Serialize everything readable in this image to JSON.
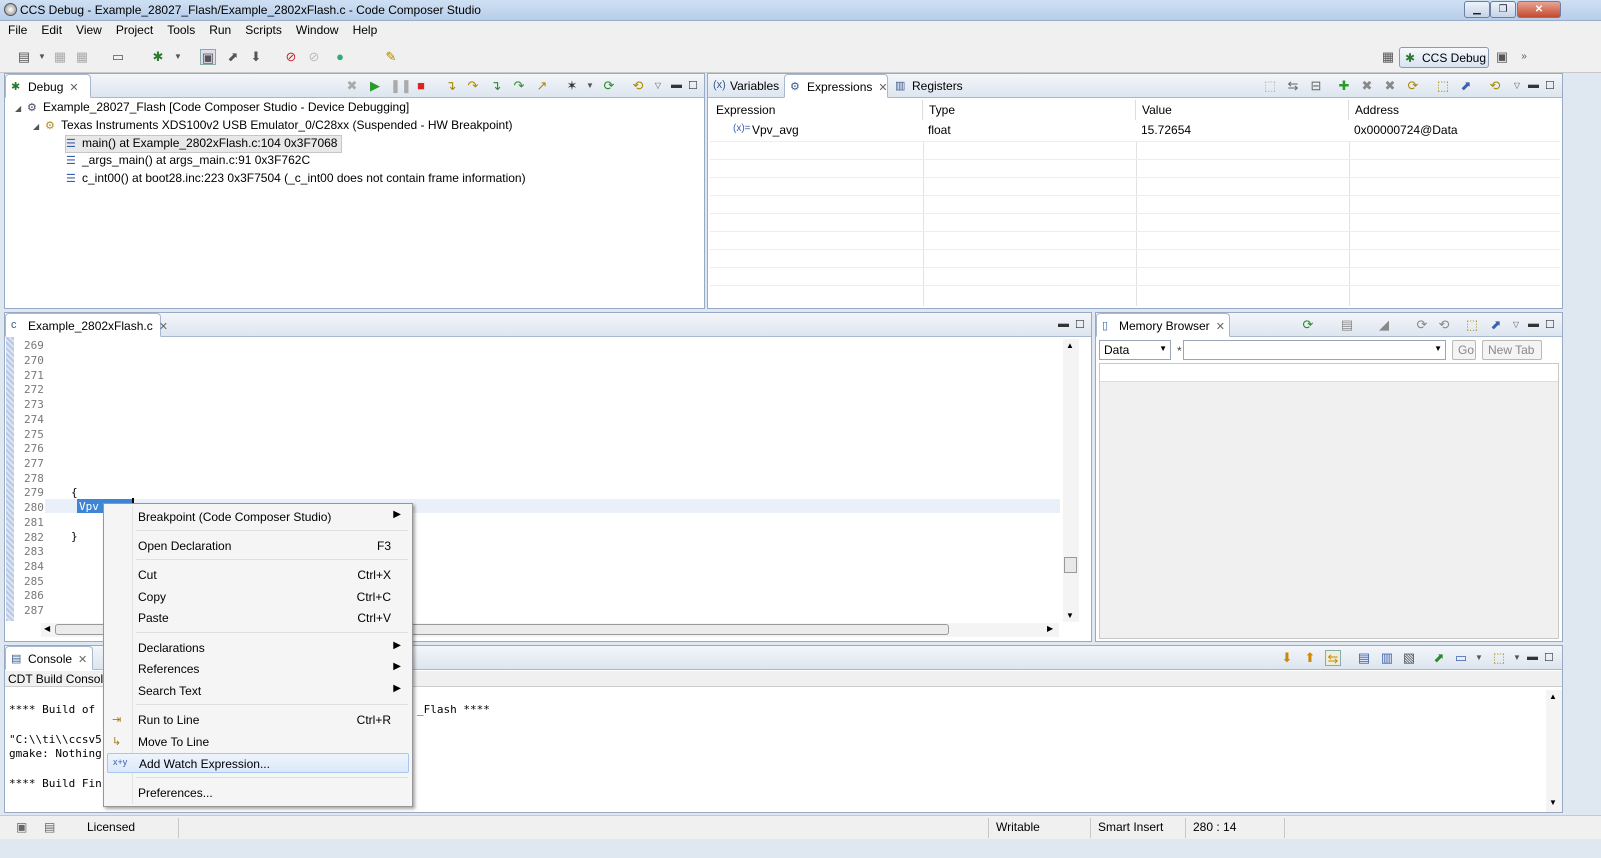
{
  "window": {
    "title": "CCS Debug - Example_28027_Flash/Example_2802xFlash.c - Code Composer Studio"
  },
  "menu": [
    "File",
    "Edit",
    "View",
    "Project",
    "Tools",
    "Run",
    "Scripts",
    "Window",
    "Help"
  ],
  "perspective": {
    "label": "CCS Debug"
  },
  "debug": {
    "tab": "Debug",
    "rows": [
      {
        "text": "Example_28027_Flash [Code Composer Studio - Device Debugging]"
      },
      {
        "text": "Texas Instruments XDS100v2 USB Emulator_0/C28xx (Suspended - HW Breakpoint)"
      },
      {
        "text": "main() at Example_2802xFlash.c:104 0x3F7068"
      },
      {
        "text": "_args_main() at args_main.c:91 0x3F762C"
      },
      {
        "text": "c_int00() at boot28.inc:223 0x3F7504  (_c_int00 does not contain frame information)"
      }
    ]
  },
  "vars": {
    "tabs": [
      "Variables",
      "Expressions",
      "Registers"
    ],
    "headers": [
      "Expression",
      "Type",
      "Value",
      "Address"
    ],
    "row": {
      "expr": "Vpv_avg",
      "type": "float",
      "value": "15.72654",
      "address": "0x00000724@Data"
    }
  },
  "editor": {
    "tab": "Example_2802xFlash.c",
    "lines": [
      "269",
      "270",
      "271",
      "272",
      "273",
      "274",
      "275",
      "276",
      "277",
      "278",
      "279",
      "280",
      "281",
      "282",
      "283",
      "284",
      "285",
      "286",
      "287"
    ],
    "selected_word": "Vpv"
  },
  "memory": {
    "tab": "Memory Browser",
    "page": "Data",
    "address_placeholder": "",
    "go": "Go",
    "newtab": "New Tab"
  },
  "console": {
    "tab": "Console",
    "subtitle": "CDT Build Console",
    "lines": [
      {
        "l": "**** Build of",
        "r": "_Flash ****"
      },
      {
        "l": "\"C:\\\\ti\\\\ccsv5",
        "r": ""
      },
      {
        "l": "gmake: Nothing",
        "r": ""
      },
      {
        "l": "**** Build Fin",
        "r": ""
      }
    ]
  },
  "contextmenu": {
    "breakpoint": "Breakpoint (Code Composer Studio)",
    "open_decl": "Open Declaration",
    "open_decl_sc": "F3",
    "cut": "Cut",
    "cut_sc": "Ctrl+X",
    "copy": "Copy",
    "copy_sc": "Ctrl+C",
    "paste": "Paste",
    "paste_sc": "Ctrl+V",
    "declarations": "Declarations",
    "references": "References",
    "search_text": "Search Text",
    "run_to_line": "Run to Line",
    "run_to_line_sc": "Ctrl+R",
    "move_to_line": "Move To Line",
    "add_watch": "Add Watch Expression...",
    "preferences": "Preferences..."
  },
  "status": {
    "licensed": "Licensed",
    "writable": "Writable",
    "insert": "Smart Insert",
    "position": "280 : 14"
  }
}
